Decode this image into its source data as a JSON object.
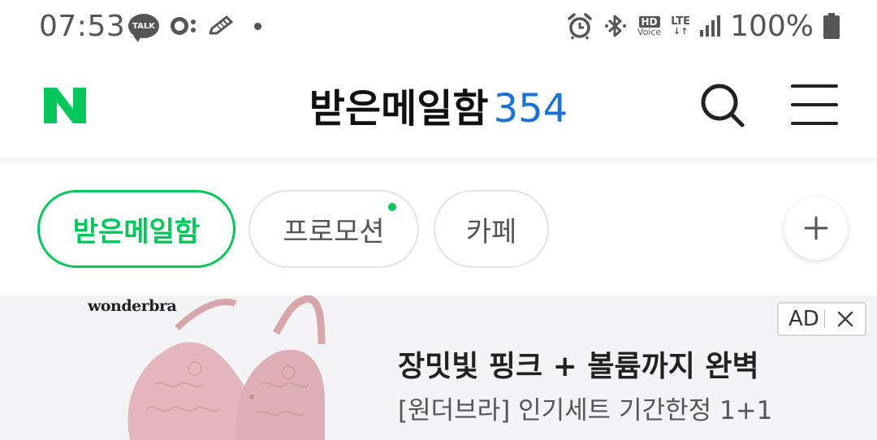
{
  "status_bar": {
    "time": "07:53",
    "left_icons": [
      "talk-icon",
      "oo-icon",
      "pencil-icon",
      "dot"
    ],
    "talk_label": "TALK",
    "right_icons": [
      "alarm-icon",
      "bluetooth-icon",
      "hd-voice-icon",
      "lte-icon",
      "signal-icon",
      "battery-icon"
    ],
    "hd": "HD",
    "voice": "Voice",
    "lte": "LTE",
    "battery": "100%"
  },
  "header": {
    "logo_icon": "naver-n-logo",
    "title": "받은메일함",
    "count": "354",
    "search_icon": "search-icon",
    "menu_icon": "hamburger-menu-icon"
  },
  "tabs": [
    {
      "label": "받은메일함",
      "active": true
    },
    {
      "label": "프로모션",
      "active": false,
      "new_dot": true
    },
    {
      "label": "카페",
      "active": false
    }
  ],
  "add_tab_icon": "plus-icon",
  "ad": {
    "brand": "wonderbra",
    "badge": "AD",
    "close_icon": "close-icon",
    "title": "장밋빛 핑크 + 볼륨까지 완벽",
    "subtitle": "[원더브라] 인기세트 기간한정 1+1"
  },
  "colors": {
    "accent_green": "#03c75a",
    "count_blue": "#1a73d8",
    "status_gray": "#555555",
    "ad_background": "#f4f4f6"
  }
}
